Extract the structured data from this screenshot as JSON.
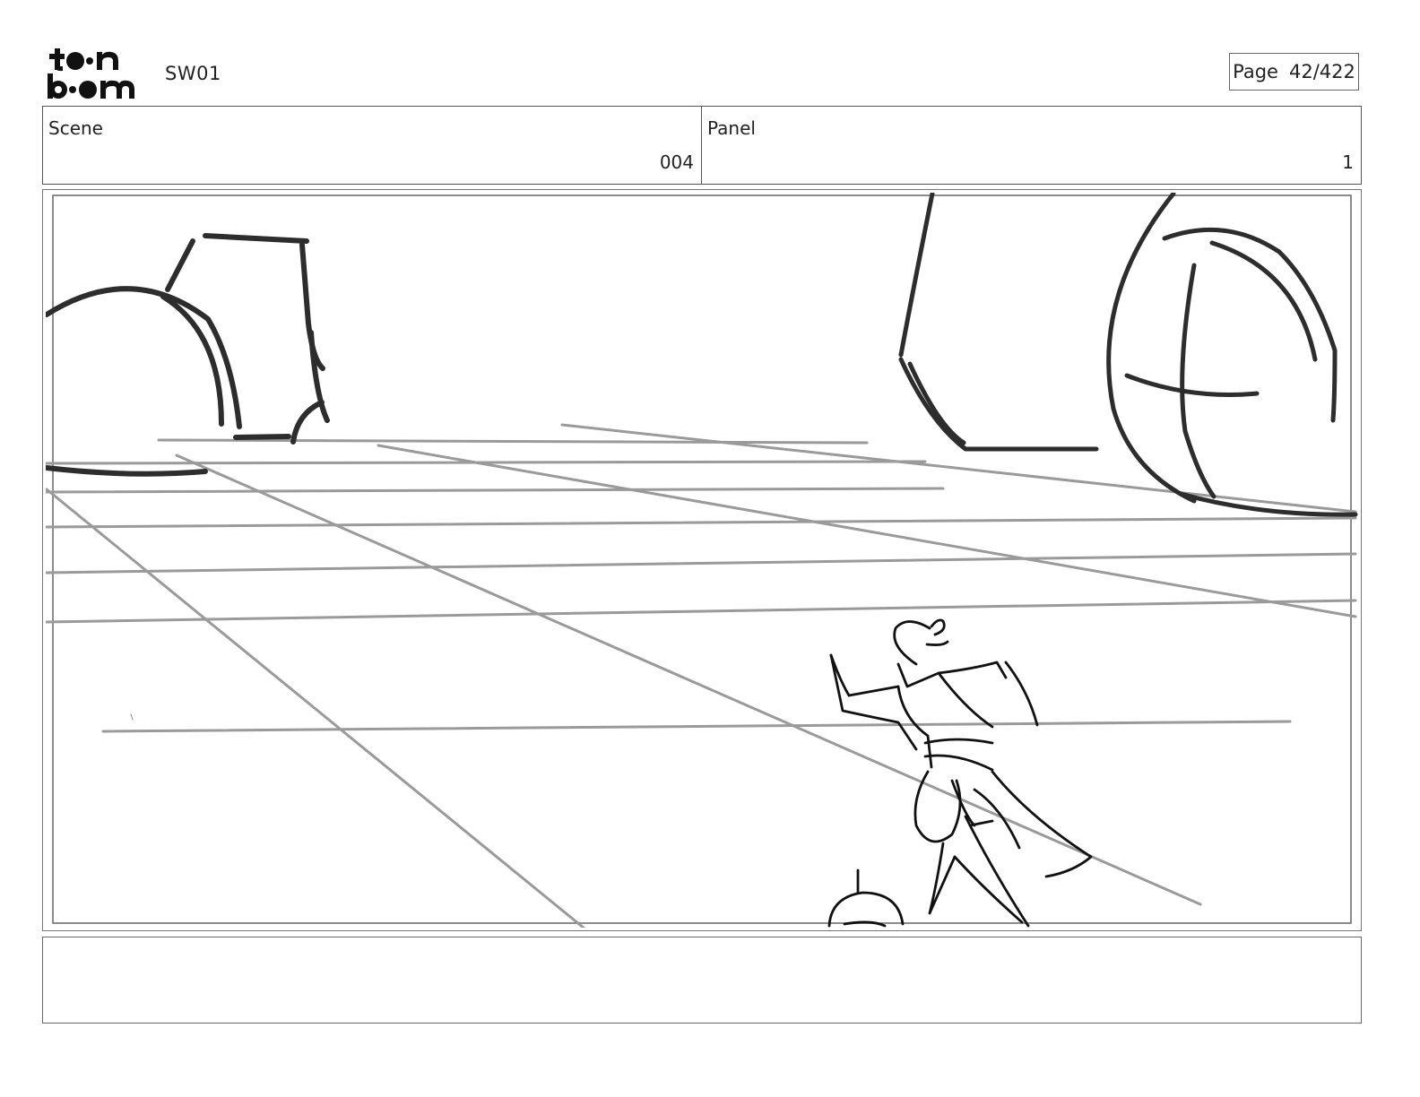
{
  "header": {
    "logo_text": "toonboom",
    "project": "SW01",
    "page_label": "Page",
    "page_number": "42/422"
  },
  "info": {
    "scene_label": "Scene",
    "scene_value": "004",
    "panel_label": "Panel",
    "panel_value": "1"
  },
  "notes": {
    "text": ""
  }
}
